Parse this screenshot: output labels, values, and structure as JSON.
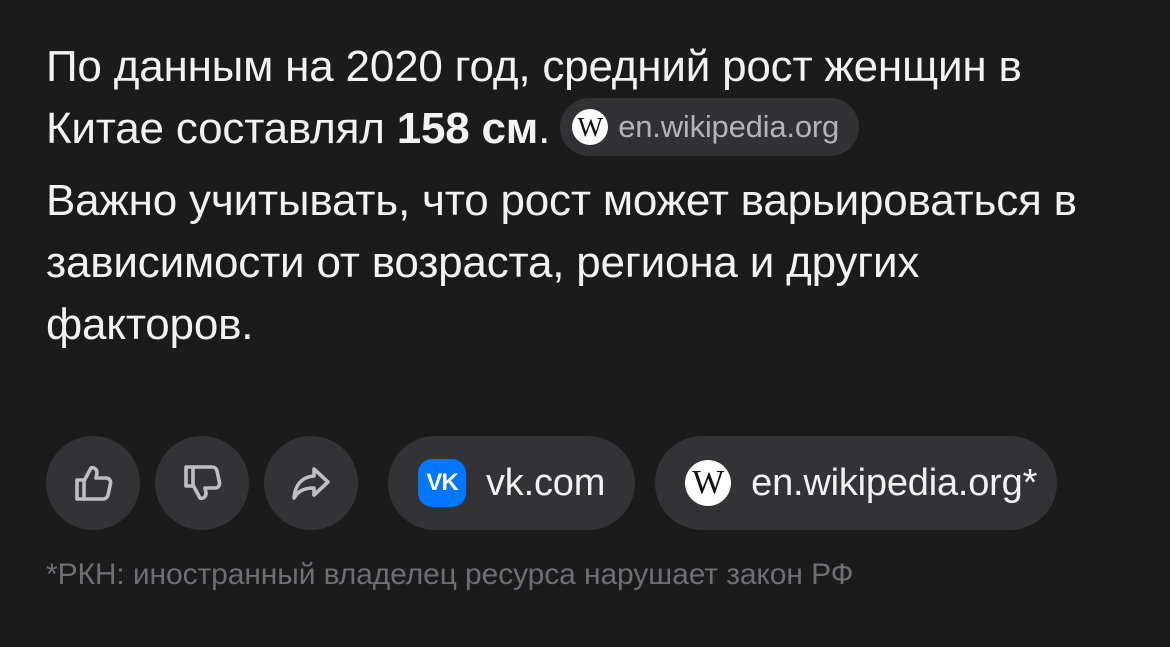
{
  "answer": {
    "para1_prefix": "По данным на 2020 год, средний рост женщин в Китае составлял ",
    "para1_value": "158 см",
    "para1_suffix": ".",
    "para1_source": "en.wikipedia.org",
    "para2": "Важно учитывать, что рост может варьироваться в зависимости от возраста, региона и других факторов."
  },
  "actions": {
    "like_icon": "thumbs-up-icon",
    "dislike_icon": "thumbs-down-icon",
    "share_icon": "share-icon"
  },
  "sources": [
    {
      "label": "vk.com",
      "icon": "vk-icon",
      "icon_text": "VK",
      "icon_color": "#0077ff"
    },
    {
      "label": "en.wikipedia.org*",
      "icon": "wikipedia-icon",
      "icon_text": "W"
    }
  ],
  "wiki_letter": "W",
  "footnote": "*РКН: иностранный владелец ресурса нарушает закон РФ",
  "colors": {
    "background": "#1b1b1c",
    "text": "#f2f2f2",
    "chip": "#333335",
    "muted": "#6e6e73"
  }
}
